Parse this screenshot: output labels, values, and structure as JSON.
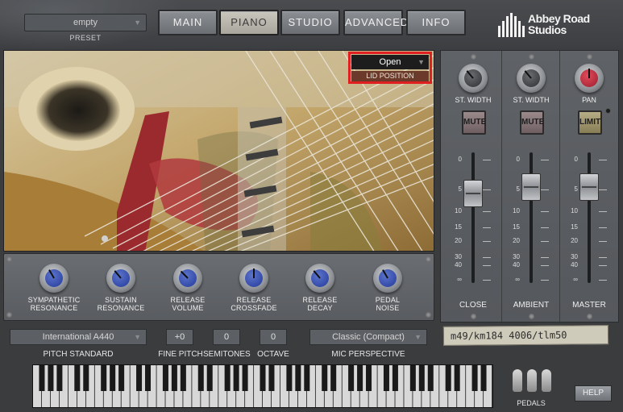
{
  "preset": {
    "value": "empty",
    "label": "PRESET"
  },
  "tabs": [
    {
      "label": "MAIN",
      "active": false
    },
    {
      "label": "PIANO",
      "active": true
    },
    {
      "label": "STUDIO",
      "active": false
    },
    {
      "label": "ADVANCED",
      "active": false
    },
    {
      "label": "INFO",
      "active": false
    }
  ],
  "logo": {
    "line1": "Abbey Road",
    "line2": "Studios"
  },
  "lid": {
    "value": "Open",
    "label": "LID POSITION"
  },
  "knobs": [
    {
      "line1": "SYMPATHETIC",
      "line2": "RESONANCE"
    },
    {
      "line1": "SUSTAIN",
      "line2": "RESONANCE"
    },
    {
      "line1": "RELEASE",
      "line2": "VOLUME"
    },
    {
      "line1": "RELEASE",
      "line2": "CROSSFADE"
    },
    {
      "line1": "RELEASE",
      "line2": "DECAY"
    },
    {
      "line1": "PEDAL",
      "line2": "NOISE"
    }
  ],
  "controls": {
    "pitch_standard": {
      "value": "International  A440",
      "label": "PITCH STANDARD"
    },
    "fine_pitch": {
      "value": "+0",
      "label": "FINE PITCH"
    },
    "semitones": {
      "value": "0",
      "label": "SEMITONES"
    },
    "octave": {
      "value": "0",
      "label": "OCTAVE"
    },
    "mic_perspective": {
      "value": "Classic (Compact)",
      "label": "MIC PERSPECTIVE"
    }
  },
  "mixer": {
    "strips": [
      {
        "knob_label": "ST. WIDTH",
        "button": "MUTE",
        "name": "CLOSE"
      },
      {
        "knob_label": "ST. WIDTH",
        "button": "MUTE",
        "name": "AMBIENT"
      },
      {
        "knob_label": "PAN",
        "button": "LIMIT",
        "name": "MASTER"
      }
    ],
    "scale": [
      "0",
      "5",
      "10",
      "15",
      "20",
      "30",
      "40",
      "∞"
    ]
  },
  "mic_note": "m49/km184 4006/tlm50",
  "pedals_label": "PEDALS",
  "help_label": "HELP"
}
